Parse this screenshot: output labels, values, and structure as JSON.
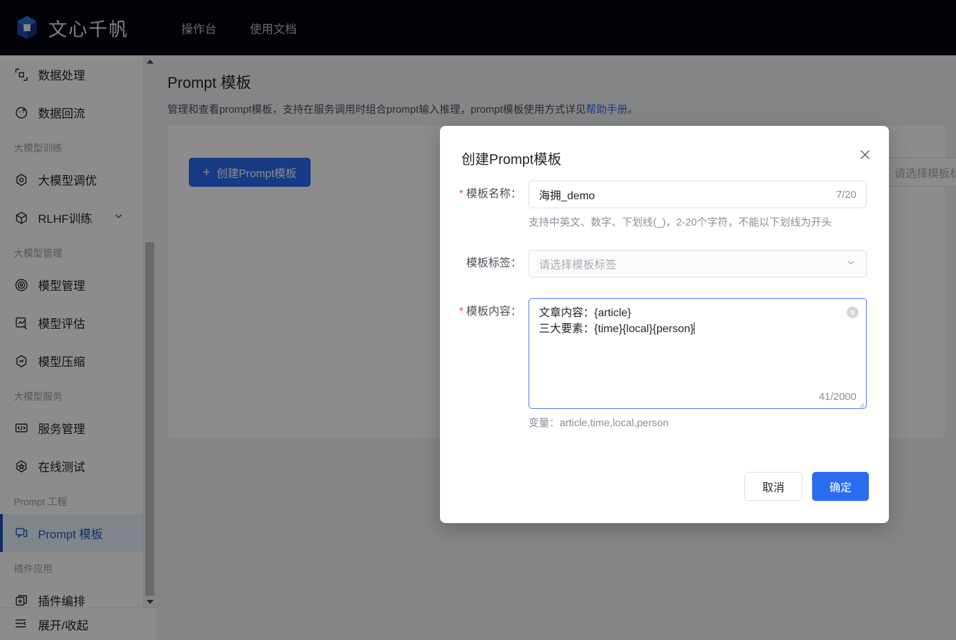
{
  "header": {
    "brand": "文心千帆",
    "logo_icon": "cube-logo-icon",
    "nav": [
      {
        "label": "操作台",
        "name": "nav-console"
      },
      {
        "label": "使用文档",
        "name": "nav-docs"
      }
    ]
  },
  "sidebar": {
    "items": [
      {
        "type": "item",
        "label": "数据处理",
        "icon": "crop-frame-icon",
        "active": false,
        "expandable": false
      },
      {
        "type": "item",
        "label": "数据回流",
        "icon": "refresh-circle-icon",
        "active": false,
        "expandable": false
      },
      {
        "type": "group",
        "label": "大模型训练"
      },
      {
        "type": "item",
        "label": "大模型调优",
        "icon": "hexagon-tune-icon",
        "active": false,
        "expandable": false
      },
      {
        "type": "item",
        "label": "RLHF训练",
        "icon": "cube-icon",
        "active": false,
        "expandable": true
      },
      {
        "type": "group",
        "label": "大模型管理"
      },
      {
        "type": "item",
        "label": "模型管理",
        "icon": "target-circle-icon",
        "active": false,
        "expandable": false
      },
      {
        "type": "item",
        "label": "模型评估",
        "icon": "chart-pen-icon",
        "active": false,
        "expandable": false
      },
      {
        "type": "item",
        "label": "模型压缩",
        "icon": "hexagon-chart-icon",
        "active": false,
        "expandable": false
      },
      {
        "type": "group",
        "label": "大模型服务"
      },
      {
        "type": "item",
        "label": "服务管理",
        "icon": "code-monitor-icon",
        "active": false,
        "expandable": false
      },
      {
        "type": "item",
        "label": "在线测试",
        "icon": "hexagon-star-icon",
        "active": false,
        "expandable": false
      },
      {
        "type": "group",
        "label": "Prompt 工程"
      },
      {
        "type": "item",
        "label": "Prompt 模板",
        "icon": "chat-template-icon",
        "active": true,
        "expandable": false
      },
      {
        "type": "group",
        "label": "插件应用"
      },
      {
        "type": "item",
        "label": "插件编排",
        "icon": "layers-icon",
        "active": false,
        "expandable": false
      }
    ],
    "footer": {
      "label": "展开/收起",
      "icon": "collapse-menu-icon"
    }
  },
  "page": {
    "title": "Prompt 模板",
    "description_before": "管理和查看prompt模板，支持在服务调用时组合prompt输入推理，prompt模板使用方式详见",
    "description_link": "帮助手册",
    "description_after": "。",
    "create_button": "创建Prompt模板",
    "create_button_icon": "plus-icon",
    "filter_placeholder": "请选择模板标签"
  },
  "modal": {
    "title": "创建Prompt模板",
    "close_icon": "close-icon",
    "name_field": {
      "label": "模板名称：",
      "required": true,
      "value": "海拥_demo",
      "counter": "7/20",
      "hint": "支持中英文、数字、下划线(_)，2-20个字符，不能以下划线为开头"
    },
    "tag_field": {
      "label": "模板标签：",
      "required": false,
      "placeholder": "请选择模板标签",
      "caret_icon": "chevron-down-icon"
    },
    "content_field": {
      "label": "模板内容：",
      "required": true,
      "value": "文章内容：{article}\n三大要素：{time}{local}{person}",
      "counter": "41/2000",
      "clear_icon": "clear-circle-icon",
      "variables_label": "变量：",
      "variables_value": "article,time,local,person"
    },
    "cancel_button": "取消",
    "confirm_button": "确定"
  },
  "colors": {
    "brand_blue": "#2b6cf0",
    "topbar_bg": "#04070f",
    "active_blue": "#2859c5",
    "required_red": "#e34d59",
    "page_bg": "#f0f2f5"
  }
}
